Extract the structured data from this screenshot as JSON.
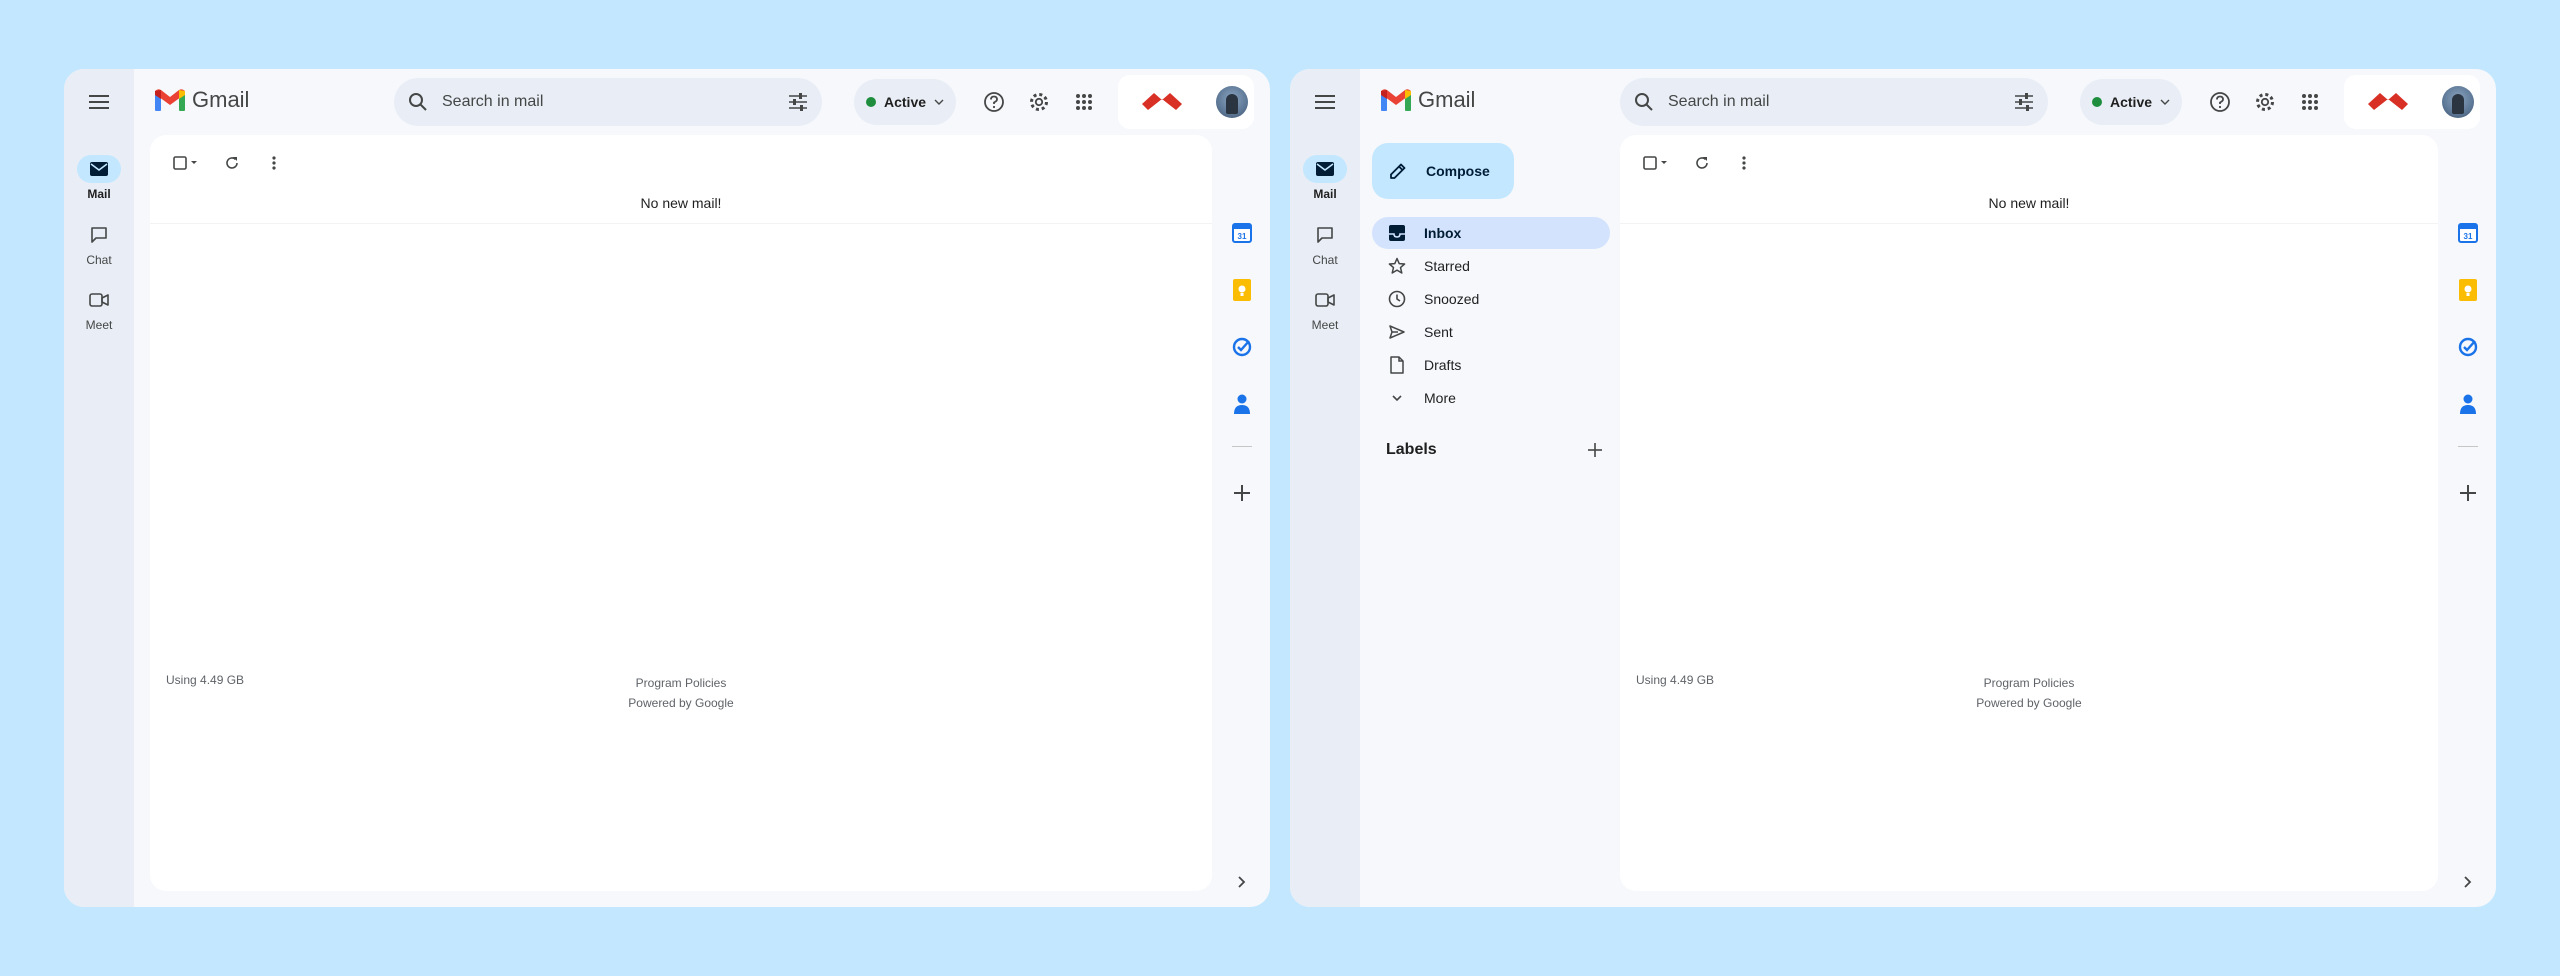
{
  "app": {
    "name": "Gmail"
  },
  "rail": {
    "mail_label": "Mail",
    "chat_label": "Chat",
    "meet_label": "Meet"
  },
  "search": {
    "placeholder": "Search in mail"
  },
  "status": {
    "label": "Active",
    "color": "#1e8e3e"
  },
  "mailbox": {
    "empty_message": "No new mail!",
    "storage": "Using 4.49 GB",
    "footer_links": [
      "Program Policies",
      "Powered by Google"
    ]
  },
  "compose": {
    "label": "Compose"
  },
  "folders": [
    {
      "label": "Inbox",
      "icon": "inbox-icon",
      "active": true
    },
    {
      "label": "Starred",
      "icon": "star-icon"
    },
    {
      "label": "Snoozed",
      "icon": "clock-icon"
    },
    {
      "label": "Sent",
      "icon": "send-icon"
    },
    {
      "label": "Drafts",
      "icon": "draft-icon"
    },
    {
      "label": "More",
      "icon": "chevron-down-icon"
    }
  ],
  "labels": {
    "title": "Labels"
  },
  "colors": {
    "background": "#c2e7ff",
    "compose_bg": "#c2e7ff",
    "active_folder_bg": "#d3e3fd",
    "window_bg": "#f6f8fc"
  }
}
